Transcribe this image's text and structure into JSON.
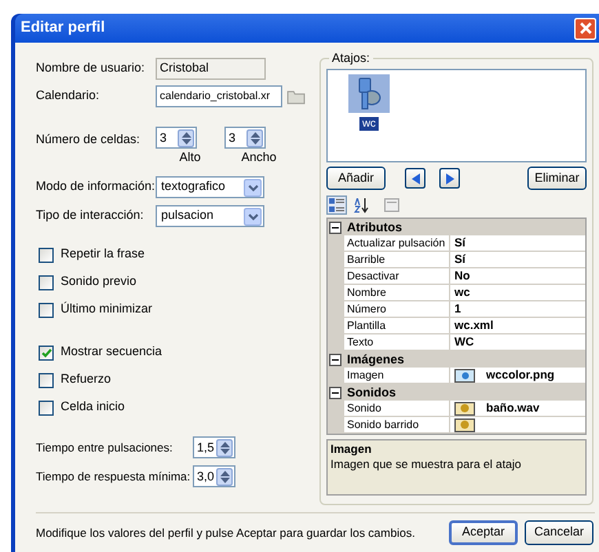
{
  "window": {
    "title": "Editar perfil"
  },
  "form": {
    "user_name": {
      "label": "Nombre de usuario:",
      "value": "Cristobal",
      "read_only": true
    },
    "calendar": {
      "label": "Calendario:",
      "value": "calendario_cristobal.xr",
      "read_only": false
    },
    "cells": {
      "label": "Número de celdas:",
      "spinners": [
        {
          "value": "3",
          "caption": "Alto"
        },
        {
          "value": "3",
          "caption": "Ancho"
        }
      ]
    },
    "info_mode": {
      "label": "Modo de información:",
      "value": "textografico"
    },
    "interaction": {
      "label": "Tipo de interacción:",
      "value": "pulsacion"
    },
    "option_groups": [
      [
        {
          "label": "Repetir la frase",
          "checked": false
        },
        {
          "label": "Sonido previo",
          "checked": false
        },
        {
          "label": "Último minimizar",
          "checked": false
        }
      ],
      [
        {
          "label": "Mostrar secuencia",
          "checked": true
        },
        {
          "label": "Refuerzo",
          "checked": false
        },
        {
          "label": "Celda inicio",
          "checked": false
        }
      ]
    ],
    "timings": [
      {
        "label": "Tiempo entre pulsaciones:",
        "value": "1,5"
      },
      {
        "label": "Tiempo de respuesta mínima:",
        "value": "3,0"
      }
    ]
  },
  "shortcuts": {
    "title": "Atajos:",
    "items": [
      {
        "label": "wc",
        "selected": true
      }
    ],
    "add_button": "Añadir",
    "remove_button": "Eliminar",
    "toolbar": [
      {
        "kind": "categorized",
        "selected": true
      },
      {
        "kind": "alphabetical",
        "selected": false
      },
      {
        "kind": "pages",
        "selected": false
      }
    ],
    "categories": [
      {
        "name": "Atributos",
        "expanded": true,
        "properties": [
          {
            "name": "Actualizar pulsación",
            "value": "Sí",
            "kind": "text"
          },
          {
            "name": "Barrible",
            "value": "Sí",
            "kind": "text"
          },
          {
            "name": "Desactivar",
            "value": "No",
            "kind": "text"
          },
          {
            "name": "Nombre",
            "value": "wc",
            "kind": "text"
          },
          {
            "name": "Número",
            "value": "1",
            "kind": "text"
          },
          {
            "name": "Plantilla",
            "value": "wc.xml",
            "kind": "text"
          },
          {
            "name": "Texto",
            "value": "WC",
            "kind": "text"
          }
        ]
      },
      {
        "name": "Imágenes",
        "expanded": true,
        "properties": [
          {
            "name": "Imagen",
            "value": "wccolor.png",
            "kind": "image"
          }
        ]
      },
      {
        "name": "Sonidos",
        "expanded": true,
        "properties": [
          {
            "name": "Sonido",
            "value": "baño.wav",
            "kind": "sound"
          },
          {
            "name": "Sonido barrido",
            "kind": "sound"
          }
        ]
      }
    ],
    "description": {
      "title": "Imagen",
      "text": "Imagen que se muestra para el atajo"
    }
  },
  "status_text": "Modifique los valores del perfil y pulse Aceptar para guardar los cambios.",
  "buttons": [
    {
      "label": "Aceptar",
      "default": true
    },
    {
      "label": "Cancelar",
      "default": false
    }
  ]
}
